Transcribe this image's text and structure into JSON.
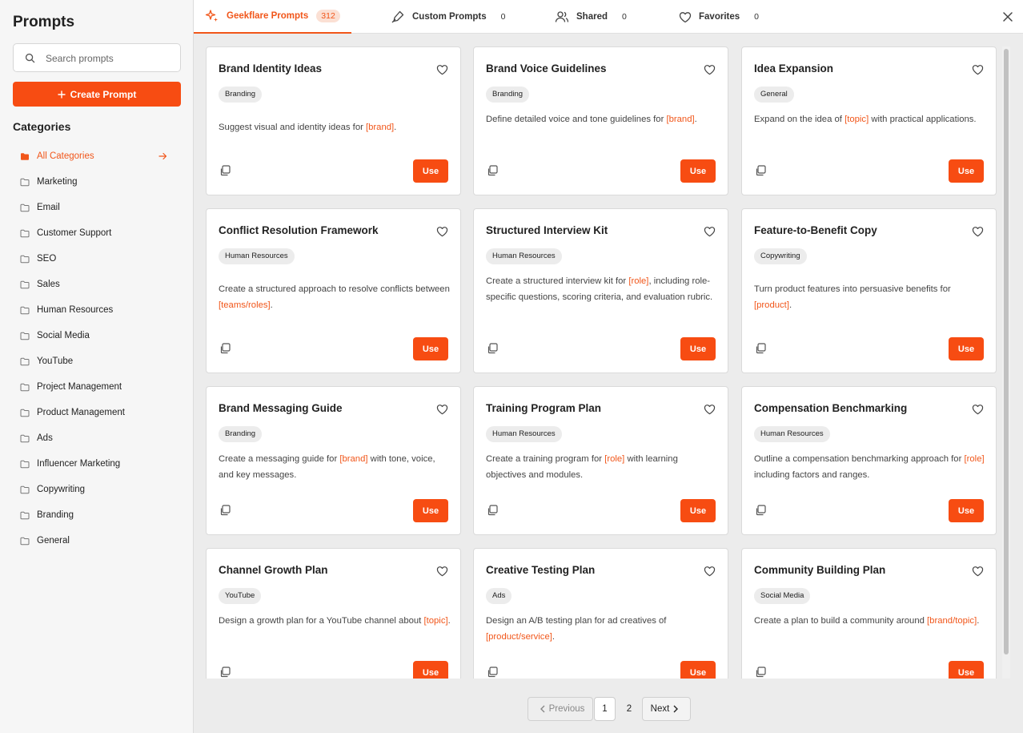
{
  "sidebar": {
    "title": "Prompts",
    "search_placeholder": "Search prompts",
    "create_label": "Create Prompt",
    "categories_title": "Categories",
    "categories": [
      {
        "label": "All Categories",
        "active": true
      },
      {
        "label": "Marketing"
      },
      {
        "label": "Email"
      },
      {
        "label": "Customer Support"
      },
      {
        "label": "SEO"
      },
      {
        "label": "Sales"
      },
      {
        "label": "Human Resources"
      },
      {
        "label": "Social Media"
      },
      {
        "label": "YouTube"
      },
      {
        "label": "Project Management"
      },
      {
        "label": "Product Management"
      },
      {
        "label": "Ads"
      },
      {
        "label": "Influencer Marketing"
      },
      {
        "label": "Copywriting"
      },
      {
        "label": "Branding"
      },
      {
        "label": "General"
      }
    ]
  },
  "tabs": [
    {
      "label": "Geekflare Prompts",
      "count": "312",
      "icon": "sparkle-icon",
      "active": true
    },
    {
      "label": "Custom Prompts",
      "count": "0",
      "icon": "pen-icon"
    },
    {
      "label": "Shared",
      "count": "0",
      "icon": "users-icon"
    },
    {
      "label": "Favorites",
      "count": "0",
      "icon": "heart-icon"
    }
  ],
  "cards": [
    {
      "title": "Brand Identity Ideas",
      "tag": "Branding",
      "desc": [
        {
          "t": "Suggest visual and identity ideas for "
        },
        {
          "v": "[brand]"
        },
        {
          "t": "."
        }
      ]
    },
    {
      "title": "Brand Voice Guidelines",
      "tag": "Branding",
      "desc": [
        {
          "t": "Define detailed voice and tone guidelines for "
        },
        {
          "v": "[brand]"
        },
        {
          "t": "."
        }
      ]
    },
    {
      "title": "Idea Expansion",
      "tag": "General",
      "desc": [
        {
          "t": "Expand on the idea of "
        },
        {
          "v": "[topic]"
        },
        {
          "t": " with practical applications."
        }
      ]
    },
    {
      "title": "Conflict Resolution Framework",
      "tag": "Human Resources",
      "desc": [
        {
          "t": "Create a structured approach to resolve conflicts between "
        },
        {
          "v": "[teams/roles]"
        },
        {
          "t": "."
        }
      ]
    },
    {
      "title": "Structured Interview Kit",
      "tag": "Human Resources",
      "desc": [
        {
          "t": "Create a structured interview kit for "
        },
        {
          "v": "[role]"
        },
        {
          "t": ", including role-specific questions, scoring criteria, and evaluation rubric."
        }
      ]
    },
    {
      "title": "Feature-to-Benefit Copy",
      "tag": "Copywriting",
      "desc": [
        {
          "t": "Turn product features into persuasive benefits for "
        },
        {
          "v": "[product]"
        },
        {
          "t": "."
        }
      ]
    },
    {
      "title": "Brand Messaging Guide",
      "tag": "Branding",
      "desc": [
        {
          "t": "Create a messaging guide for "
        },
        {
          "v": "[brand]"
        },
        {
          "t": " with tone, voice, and key messages."
        }
      ]
    },
    {
      "title": "Training Program Plan",
      "tag": "Human Resources",
      "desc": [
        {
          "t": "Create a training program for "
        },
        {
          "v": "[role]"
        },
        {
          "t": " with learning objectives and modules."
        }
      ]
    },
    {
      "title": "Compensation Benchmarking",
      "tag": "Human Resources",
      "desc": [
        {
          "t": "Outline a compensation benchmarking approach for "
        },
        {
          "v": "[role]"
        },
        {
          "t": " including factors and ranges."
        }
      ]
    },
    {
      "title": "Channel Growth Plan",
      "tag": "YouTube",
      "desc": [
        {
          "t": "Design a growth plan for a YouTube channel about "
        },
        {
          "v": "[topic]"
        },
        {
          "t": "."
        }
      ]
    },
    {
      "title": "Creative Testing Plan",
      "tag": "Ads",
      "desc": [
        {
          "t": "Design an A/B testing plan for ad creatives of "
        },
        {
          "v": "[product/service]"
        },
        {
          "t": "."
        }
      ]
    },
    {
      "title": "Community Building Plan",
      "tag": "Social Media",
      "desc": [
        {
          "t": "Create a plan to build a community around "
        },
        {
          "v": "[brand/topic]"
        },
        {
          "t": "."
        }
      ]
    }
  ],
  "card_use_label": "Use",
  "pagination": {
    "prev_label": "Previous",
    "pages": [
      "1",
      "2"
    ],
    "current": "1",
    "next_label": "Next"
  },
  "colors": {
    "accent": "#f74c12",
    "variable_text": "#f1561a"
  }
}
